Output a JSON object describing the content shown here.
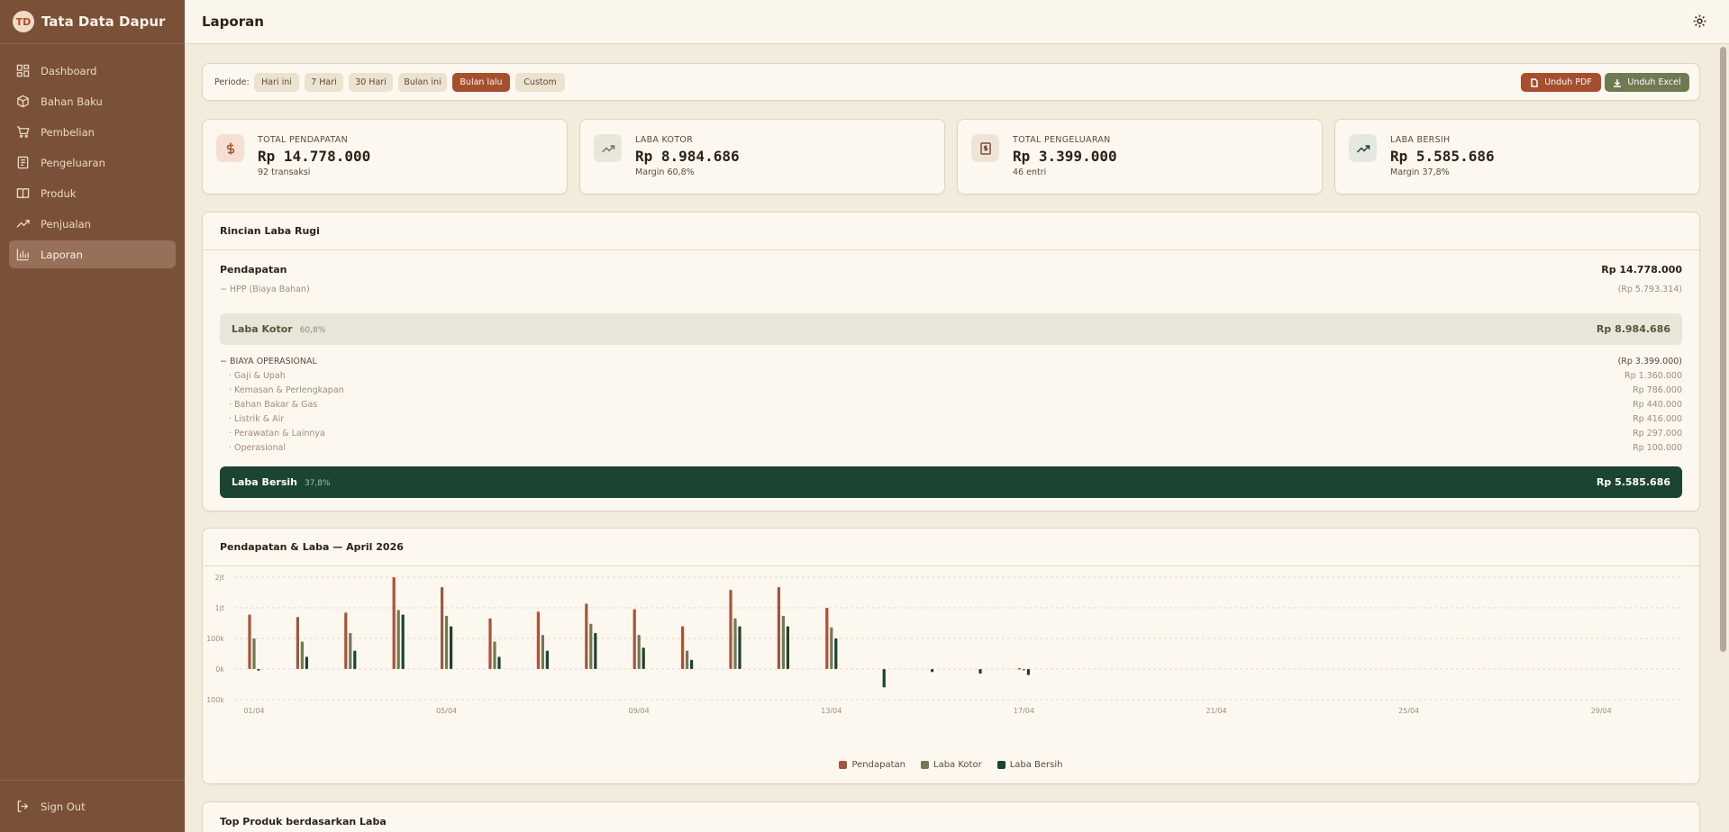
{
  "brand": {
    "name": "Tata Data Dapur",
    "logo": "TD"
  },
  "nav": [
    {
      "label": "Dashboard",
      "icon": "dashboard-icon"
    },
    {
      "label": "Bahan Baku",
      "icon": "box-icon"
    },
    {
      "label": "Pembelian",
      "icon": "cart-icon"
    },
    {
      "label": "Pengeluaran",
      "icon": "receipt-icon"
    },
    {
      "label": "Produk",
      "icon": "book-icon"
    },
    {
      "label": "Penjualan",
      "icon": "trend-icon"
    },
    {
      "label": "Laporan",
      "icon": "bar-chart-icon",
      "active": true
    }
  ],
  "signout": {
    "label": "Sign Out",
    "icon": "logout-icon"
  },
  "header": {
    "title": "Laporan",
    "settings_icon": "gear-icon"
  },
  "periode": {
    "label": "Periode:",
    "options": [
      "Hari ini",
      "7 Hari",
      "30 Hari",
      "Bulan ini",
      "Bulan lalu",
      "Custom"
    ],
    "selected": "Bulan lalu",
    "pdf_label": "Unduh PDF",
    "excel_label": "Unduh Excel"
  },
  "stats": [
    {
      "label": "TOTAL PENDAPATAN",
      "value": "Rp 14.778.000",
      "sub": "92 transaksi",
      "icon": "dollar-icon"
    },
    {
      "label": "LABA KOTOR",
      "value": "Rp 8.984.686",
      "sub": "Margin 60,8%",
      "icon": "trend-up-icon"
    },
    {
      "label": "TOTAL PENGELUARAN",
      "value": "Rp 3.399.000",
      "sub": "46 entri",
      "icon": "receipt-icon"
    },
    {
      "label": "LABA BERSIH",
      "value": "Rp 5.585.686",
      "sub": "Margin 37,8%",
      "icon": "trend-up-icon"
    }
  ],
  "profit_loss": {
    "title": "Rincian Laba Rugi",
    "revenue": {
      "label": "Pendapatan",
      "value": "Rp 14.778.000"
    },
    "cogs": {
      "label": "− HPP (Biaya Bahan)",
      "value": "(Rp 5.793.314)"
    },
    "gross": {
      "label": "Laba Kotor",
      "pct": "60,8%",
      "value": "Rp 8.984.686"
    },
    "opex": {
      "label": "− BIAYA OPERASIONAL",
      "value": "(Rp 3.399.000)"
    },
    "opex_items": [
      {
        "label": "· Gaji & Upah",
        "value": "Rp 1.360.000"
      },
      {
        "label": "· Kemasan & Perlengkapan",
        "value": "Rp 786.000"
      },
      {
        "label": "· Bahan Bakar & Gas",
        "value": "Rp 440.000"
      },
      {
        "label": "· Listrik & Air",
        "value": "Rp 416.000"
      },
      {
        "label": "· Perawatan & Lainnya",
        "value": "Rp 297.000"
      },
      {
        "label": "· Operasional",
        "value": "Rp 100.000"
      }
    ],
    "net": {
      "label": "Laba Bersih",
      "pct": "37,8%",
      "value": "Rp 5.585.686"
    }
  },
  "chart_data": {
    "type": "bar",
    "title": "Pendapatan & Laba — April 2026",
    "y_scale": "symlog",
    "y_ticks": [
      "2jt",
      "1jt",
      "100k",
      "0k",
      "100k"
    ],
    "x_tick_labels": [
      "01/04",
      "05/04",
      "09/04",
      "13/04",
      "17/04",
      "21/04",
      "25/04",
      "29/04"
    ],
    "categories": [
      "01/04",
      "02/04",
      "03/04",
      "04/04",
      "05/04",
      "06/04",
      "07/04",
      "08/04",
      "09/04",
      "10/04",
      "11/04",
      "12/04",
      "13/04",
      "14/04",
      "15/04",
      "16/04",
      "17/04",
      "18/04",
      "19/04",
      "20/04",
      "21/04",
      "22/04",
      "23/04",
      "24/04",
      "25/04",
      "26/04",
      "27/04",
      "28/04",
      "29/04",
      "30/04"
    ],
    "series": [
      {
        "name": "Pendapatan",
        "color": "#a9543a",
        "values": [
          600000,
          500000,
          700000,
          2000000,
          1600000,
          450000,
          750000,
          1100000,
          900000,
          250000,
          1500000,
          1600000,
          1000000,
          0,
          0,
          0,
          3000,
          0,
          0,
          0,
          0,
          0,
          0,
          0,
          0,
          0,
          0,
          0,
          0,
          0
        ]
      },
      {
        "name": "Laba Kotor",
        "color": "#6f7a52",
        "values": [
          100000,
          90000,
          150000,
          850000,
          550000,
          90000,
          130000,
          300000,
          130000,
          60000,
          450000,
          550000,
          230000,
          0,
          0,
          0,
          -3000,
          0,
          0,
          0,
          0,
          0,
          0,
          0,
          0,
          0,
          0,
          0,
          0,
          0
        ]
      },
      {
        "name": "Laba Bersih",
        "color": "#1c4432",
        "values": [
          -5000,
          40000,
          60000,
          600000,
          250000,
          40000,
          60000,
          150000,
          70000,
          30000,
          250000,
          250000,
          100000,
          -60000,
          -10000,
          -15000,
          -20000,
          0,
          0,
          0,
          0,
          0,
          0,
          0,
          0,
          0,
          0,
          0,
          0,
          0
        ]
      }
    ]
  },
  "top_products": {
    "title": "Top Produk berdasarkan Laba"
  }
}
